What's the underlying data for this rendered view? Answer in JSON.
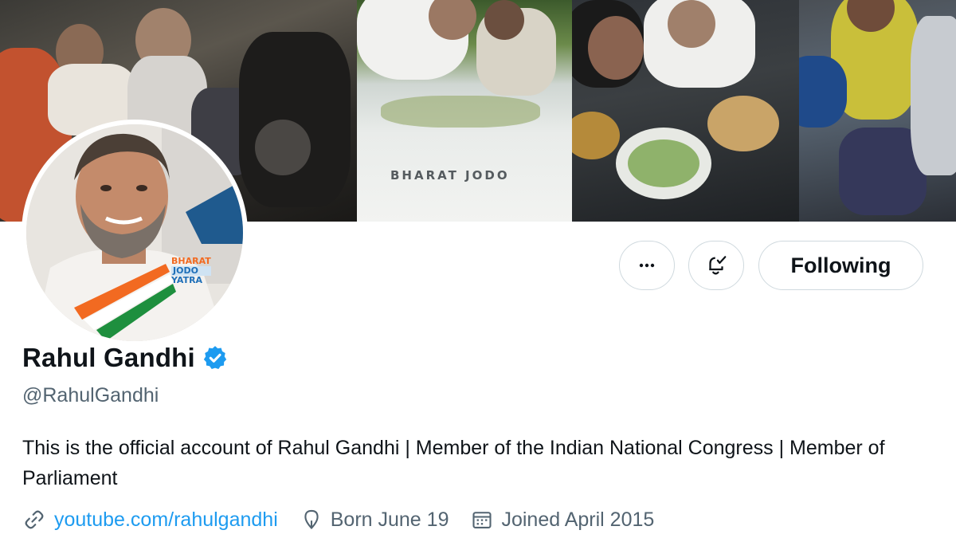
{
  "banner": {
    "text": "BHARAT JODO"
  },
  "avatar": {
    "logo_lines": [
      "BHARAT",
      "JODO",
      "YATRA"
    ]
  },
  "actions": {
    "more_icon": "more-horizontal-icon",
    "notify_icon": "bell-check-icon",
    "following_label": "Following"
  },
  "profile": {
    "name": "Rahul Gandhi",
    "verified_icon": "verified-badge-icon",
    "handle": "@RahulGandhi",
    "bio": "This is the official account of Rahul Gandhi | Member of the Indian National Congress | Member of Parliament",
    "website": "youtube.com/rahulgandhi",
    "birthday": "Born June 19",
    "joined": "Joined April 2015"
  },
  "colors": {
    "accent": "#1d9bf0",
    "text": "#0f1419",
    "muted": "#536471",
    "border": "#cfd9de"
  }
}
